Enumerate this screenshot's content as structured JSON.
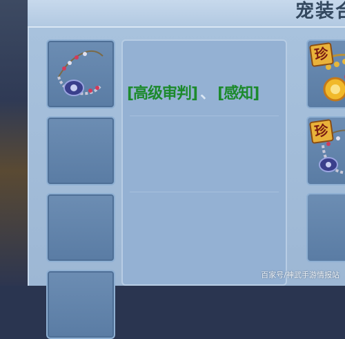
{
  "header": {
    "title": "宠装合"
  },
  "description": {
    "skill_1": "[高级审判]",
    "separator": "、",
    "skill_2": "[感知]"
  },
  "side_slots": [
    {
      "badge": "珍",
      "icon": "sun-amulet-icon"
    },
    {
      "badge": "珍",
      "icon": "necklace-icon"
    }
  ],
  "watermark": "百家号/神武手游情报站",
  "colors": {
    "skill_text": "#1c8a2c",
    "panel": "#a9c3de",
    "slot": "#5a7ca4"
  }
}
